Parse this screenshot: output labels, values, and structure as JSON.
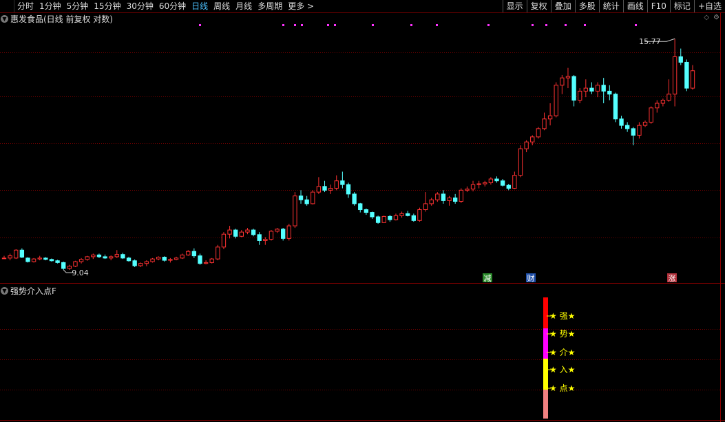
{
  "toolbar": {
    "periods": [
      "分时",
      "1分钟",
      "5分钟",
      "15分钟",
      "30分钟",
      "60分钟",
      "日线",
      "周线",
      "月线",
      "多周期",
      "更多 >"
    ],
    "active_period": "日线",
    "right_buttons": [
      "显示",
      "复权",
      "叠加",
      "多股",
      "统计",
      "画线",
      "F10",
      "标记",
      "+自选"
    ]
  },
  "chart": {
    "title": "惠发食品(日线 前复权 对数)",
    "high_label": "15.77",
    "low_label": "9.04",
    "event_markers": [
      {
        "text": "减",
        "color": "#2a8a2a"
      },
      {
        "text": "财",
        "color": "#1f4fa8"
      },
      {
        "text": "涨",
        "color": "#b0303a"
      }
    ]
  },
  "indicator": {
    "title": "强势介入点F",
    "labels": [
      "★ 强★",
      "★ 势★",
      "★ 介★",
      "★ 入★",
      "★ 点★"
    ],
    "bar_colors": [
      "#ff0000",
      "#ff00ff",
      "#ffff00",
      "#f08080"
    ]
  },
  "chart_data": {
    "type": "candlestick",
    "x": [
      "k1",
      "k2",
      "k3",
      "k4",
      "k5",
      "k6",
      "k7",
      "k8",
      "k9",
      "k10",
      "k11",
      "k12",
      "k13",
      "k14",
      "k15",
      "k16",
      "k17",
      "k18",
      "k19",
      "k20",
      "k21",
      "k22",
      "k23",
      "k24",
      "k25",
      "k26",
      "k27",
      "k28",
      "k29",
      "k30",
      "k31",
      "k32",
      "k33",
      "k34",
      "k35",
      "k36",
      "k37",
      "k38",
      "k39",
      "k40",
      "k41",
      "k42",
      "k43",
      "k44",
      "k45",
      "k46",
      "k47",
      "k48",
      "k49",
      "k50",
      "k51",
      "k52",
      "k53",
      "k54",
      "k55",
      "k56",
      "k57",
      "k58",
      "k59",
      "k60",
      "k61",
      "k62",
      "k63",
      "k64",
      "k65",
      "k66",
      "k67",
      "k68",
      "k69",
      "k70",
      "k71",
      "k72",
      "k73",
      "k74",
      "k75",
      "k76",
      "k77",
      "k78",
      "k79",
      "k80",
      "k81",
      "k82",
      "k83",
      "k84",
      "k85",
      "k86",
      "k87",
      "k88",
      "k89",
      "k90",
      "k91",
      "k92",
      "k93",
      "k94",
      "k95",
      "k96",
      "k97",
      "k98",
      "k99",
      "k100",
      "k101",
      "k102",
      "k103",
      "k104",
      "k105",
      "k106",
      "k107",
      "k108",
      "k109",
      "k110",
      "k111",
      "k112",
      "k113",
      "k114",
      "k115",
      "k116",
      "k117",
      "k118",
      "k119",
      "k120",
      "k121",
      "k122",
      "k123",
      "k124",
      "k125",
      "k126",
      "k127",
      "k128",
      "k129",
      "k130",
      "k131",
      "k132",
      "k133",
      "k134",
      "k135",
      "k136",
      "k137",
      "k138",
      "k139",
      "k140",
      "k141",
      "k142",
      "k143",
      "k144",
      "k145",
      "k146",
      "k147",
      "k148",
      "k149",
      "k150",
      "k151",
      "k152",
      "k153",
      "k154",
      "k155",
      "k156",
      "k157",
      "k158",
      "k159",
      "k160",
      "k161",
      "k162",
      "k163",
      "k164",
      "k165",
      "k166"
    ],
    "ohlc": [
      [
        9.3,
        9.35,
        9.28,
        9.3
      ],
      [
        9.3,
        9.4,
        9.25,
        9.35
      ],
      [
        9.3,
        9.5,
        9.28,
        9.48
      ],
      [
        9.48,
        9.52,
        9.3,
        9.32
      ],
      [
        9.3,
        9.32,
        9.2,
        9.22
      ],
      [
        9.22,
        9.3,
        9.2,
        9.28
      ],
      [
        9.28,
        9.35,
        9.25,
        9.3
      ],
      [
        9.3,
        9.32,
        9.25,
        9.27
      ],
      [
        9.27,
        9.29,
        9.22,
        9.24
      ],
      [
        9.24,
        9.26,
        9.18,
        9.2
      ],
      [
        9.2,
        9.22,
        9.04,
        9.07
      ],
      [
        9.07,
        9.15,
        9.04,
        9.12
      ],
      [
        9.12,
        9.24,
        9.1,
        9.22
      ],
      [
        9.22,
        9.3,
        9.18,
        9.27
      ],
      [
        9.27,
        9.35,
        9.24,
        9.33
      ],
      [
        9.33,
        9.4,
        9.28,
        9.37
      ],
      [
        9.37,
        9.4,
        9.3,
        9.33
      ],
      [
        9.33,
        9.38,
        9.28,
        9.3
      ],
      [
        9.3,
        9.36,
        9.25,
        9.33
      ],
      [
        9.33,
        9.48,
        9.3,
        9.38
      ],
      [
        9.38,
        9.42,
        9.28,
        9.3
      ],
      [
        9.3,
        9.33,
        9.22,
        9.24
      ],
      [
        9.24,
        9.27,
        9.1,
        9.13
      ],
      [
        9.13,
        9.2,
        9.1,
        9.18
      ],
      [
        9.18,
        9.25,
        9.12,
        9.22
      ],
      [
        9.22,
        9.3,
        9.2,
        9.28
      ],
      [
        9.28,
        9.34,
        9.25,
        9.32
      ],
      [
        9.32,
        9.34,
        9.22,
        9.25
      ],
      [
        9.25,
        9.3,
        9.2,
        9.27
      ],
      [
        9.27,
        9.33,
        9.25,
        9.3
      ],
      [
        9.3,
        9.4,
        9.28,
        9.37
      ],
      [
        9.37,
        9.48,
        9.35,
        9.45
      ],
      [
        9.45,
        9.52,
        9.3,
        9.35
      ],
      [
        9.35,
        9.4,
        9.15,
        9.18
      ],
      [
        9.18,
        9.25,
        9.16,
        9.2
      ],
      [
        9.2,
        9.3,
        9.18,
        9.28
      ],
      [
        9.28,
        9.6,
        9.25,
        9.55
      ],
      [
        9.55,
        9.9,
        9.5,
        9.85
      ],
      [
        9.85,
        10.05,
        9.75,
        9.95
      ],
      [
        9.95,
        9.98,
        9.75,
        9.8
      ],
      [
        9.8,
        9.95,
        9.78,
        9.9
      ],
      [
        9.9,
        10.0,
        9.85,
        9.95
      ],
      [
        9.95,
        9.98,
        9.8,
        9.84
      ],
      [
        9.84,
        9.9,
        9.6,
        9.7
      ],
      [
        9.7,
        9.78,
        9.6,
        9.73
      ],
      [
        9.73,
        9.95,
        9.7,
        9.92
      ],
      [
        9.92,
        10.0,
        9.88,
        9.97
      ],
      [
        9.97,
        10.0,
        9.7,
        9.75
      ],
      [
        9.75,
        10.1,
        9.7,
        10.05
      ],
      [
        10.05,
        10.9,
        10.0,
        10.8
      ],
      [
        10.8,
        10.95,
        10.6,
        10.7
      ],
      [
        10.7,
        10.8,
        10.55,
        10.6
      ],
      [
        10.6,
        10.95,
        10.58,
        10.9
      ],
      [
        10.9,
        11.3,
        10.85,
        11.05
      ],
      [
        11.05,
        11.2,
        10.9,
        10.95
      ],
      [
        10.95,
        11.1,
        10.85,
        11.0
      ],
      [
        11.0,
        11.35,
        10.95,
        11.2
      ],
      [
        11.2,
        11.45,
        11.0,
        11.1
      ],
      [
        11.1,
        11.15,
        10.75,
        10.85
      ],
      [
        10.85,
        10.9,
        10.55,
        10.6
      ],
      [
        10.6,
        10.62,
        10.38,
        10.45
      ],
      [
        10.45,
        10.48,
        10.32,
        10.38
      ],
      [
        10.38,
        10.4,
        10.22,
        10.27
      ],
      [
        10.27,
        10.3,
        10.1,
        10.13
      ],
      [
        10.13,
        10.3,
        10.12,
        10.28
      ],
      [
        10.28,
        10.32,
        10.15,
        10.2
      ],
      [
        10.2,
        10.35,
        10.18,
        10.3
      ],
      [
        10.3,
        10.4,
        10.25,
        10.35
      ],
      [
        10.35,
        10.42,
        10.28,
        10.3
      ],
      [
        10.3,
        10.35,
        10.15,
        10.18
      ],
      [
        10.18,
        10.5,
        10.15,
        10.45
      ],
      [
        10.45,
        10.9,
        10.4,
        10.6
      ],
      [
        10.6,
        10.75,
        10.55,
        10.7
      ],
      [
        10.7,
        10.9,
        10.65,
        10.85
      ],
      [
        10.85,
        10.95,
        10.6,
        10.68
      ],
      [
        10.68,
        10.8,
        10.55,
        10.75
      ],
      [
        10.75,
        10.85,
        10.6,
        10.66
      ],
      [
        10.66,
        11.0,
        10.62,
        10.95
      ],
      [
        10.95,
        11.05,
        10.9,
        10.98
      ],
      [
        10.98,
        11.2,
        10.92,
        11.1
      ],
      [
        11.1,
        11.2,
        11.0,
        11.12
      ],
      [
        11.12,
        11.2,
        11.05,
        11.15
      ],
      [
        11.15,
        11.3,
        11.1,
        11.25
      ],
      [
        11.25,
        11.32,
        11.15,
        11.2
      ],
      [
        11.2,
        11.25,
        11.05,
        11.08
      ],
      [
        11.08,
        11.12,
        10.95,
        11.0
      ],
      [
        11.0,
        11.45,
        10.98,
        11.35
      ],
      [
        11.35,
        12.2,
        11.3,
        12.1
      ],
      [
        12.1,
        12.35,
        12.0,
        12.3
      ],
      [
        12.3,
        12.5,
        12.2,
        12.45
      ],
      [
        12.45,
        12.75,
        12.4,
        12.7
      ],
      [
        12.7,
        13.2,
        12.65,
        13.0
      ],
      [
        13.0,
        13.5,
        12.8,
        13.1
      ],
      [
        13.1,
        14.2,
        13.05,
        14.1
      ],
      [
        14.1,
        14.45,
        13.8,
        14.35
      ],
      [
        14.35,
        14.7,
        14.0,
        14.4
      ],
      [
        14.4,
        14.45,
        13.4,
        13.6
      ],
      [
        13.6,
        14.0,
        13.5,
        13.9
      ],
      [
        13.9,
        14.3,
        13.7,
        14.0
      ],
      [
        14.0,
        14.2,
        13.8,
        13.9
      ],
      [
        13.9,
        14.2,
        13.7,
        14.1
      ],
      [
        14.1,
        14.35,
        13.5,
        13.9
      ],
      [
        13.9,
        14.1,
        13.6,
        13.8
      ],
      [
        13.8,
        13.85,
        12.9,
        13.0
      ],
      [
        13.0,
        13.1,
        12.7,
        12.8
      ],
      [
        12.8,
        12.9,
        12.6,
        12.7
      ],
      [
        12.7,
        12.75,
        12.2,
        12.5
      ],
      [
        12.5,
        12.9,
        12.4,
        12.8
      ],
      [
        12.8,
        12.95,
        12.75,
        12.9
      ],
      [
        12.9,
        13.4,
        12.85,
        13.35
      ],
      [
        13.35,
        13.6,
        13.2,
        13.5
      ],
      [
        13.5,
        13.65,
        13.4,
        13.6
      ],
      [
        13.6,
        14.3,
        13.55,
        13.8
      ],
      [
        13.8,
        15.77,
        13.4,
        15.1
      ],
      [
        15.1,
        15.4,
        14.8,
        14.9
      ],
      [
        14.9,
        15.0,
        13.9,
        14.0
      ],
      [
        14.0,
        14.8,
        13.95,
        14.6
      ]
    ],
    "high_label": 15.77,
    "low_label": 9.04
  }
}
